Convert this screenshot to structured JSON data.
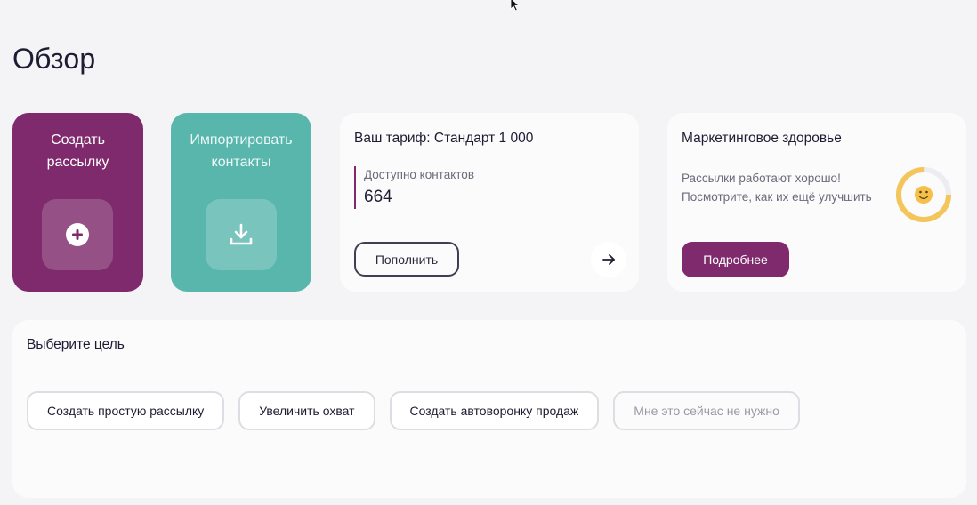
{
  "page": {
    "title": "Обзор"
  },
  "quick_actions": {
    "create": {
      "label": "Создать рассылку",
      "icon": "plus-circle-icon",
      "color": "#7e2a6c"
    },
    "import": {
      "label": "Импортировать контакты",
      "icon": "download-icon",
      "color": "#58b6ad"
    }
  },
  "tariff": {
    "title": "Ваш тариф: Стандарт 1 000",
    "contacts_label": "Доступно контактов",
    "contacts_value": "664",
    "topup_label": "Пополнить",
    "arrow_icon": "arrow-right-icon"
  },
  "health": {
    "title": "Маркетинговое здоровье",
    "description": "Рассылки работают хорошо! Посмотрите, как их ещё улучшить",
    "icon": "smiley-icon",
    "gauge_fraction": 0.75,
    "gauge_color": "#f3c55b",
    "details_label": "Подробнее"
  },
  "goals": {
    "title": "Выберите цель",
    "options": [
      "Создать простую рассылку",
      "Увеличить охват",
      "Создать автоворонку продаж",
      "Мне это сейчас не нужно"
    ]
  }
}
